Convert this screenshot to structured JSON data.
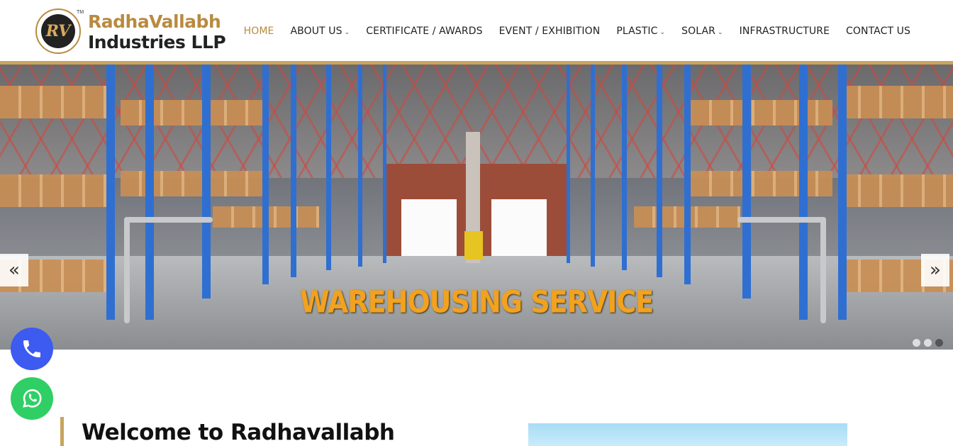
{
  "brand": {
    "name_line1": "RadhaVallabh",
    "name_line2": "Industries LLP",
    "tm": "TM",
    "mark": "RV"
  },
  "nav": {
    "items": [
      {
        "label": "HOME",
        "active": true,
        "dropdown": false
      },
      {
        "label": "ABOUT US",
        "active": false,
        "dropdown": true
      },
      {
        "label": "CERTIFICATE / AWARDS",
        "active": false,
        "dropdown": false
      },
      {
        "label": "EVENT / EXHIBITION",
        "active": false,
        "dropdown": false
      },
      {
        "label": "PLASTIC",
        "active": false,
        "dropdown": true
      },
      {
        "label": "SOLAR",
        "active": false,
        "dropdown": true
      },
      {
        "label": "INFRASTRUCTURE",
        "active": false,
        "dropdown": false
      },
      {
        "label": "CONTACT US",
        "active": false,
        "dropdown": false
      }
    ]
  },
  "slider": {
    "caption": "WAREHOUSING SERVICE",
    "prev_icon": "«",
    "next_icon": "»",
    "slide_count": 3,
    "active_slide": 3
  },
  "floating": {
    "phone_icon": "phone-icon",
    "whatsapp_icon": "whatsapp-icon"
  },
  "welcome": {
    "title": "Welcome to Radhavallabh"
  },
  "colors": {
    "gold": "#c9a45c",
    "caption": "#f2a21e",
    "phone": "#3d5af1",
    "whatsapp": "#2fcf65"
  }
}
